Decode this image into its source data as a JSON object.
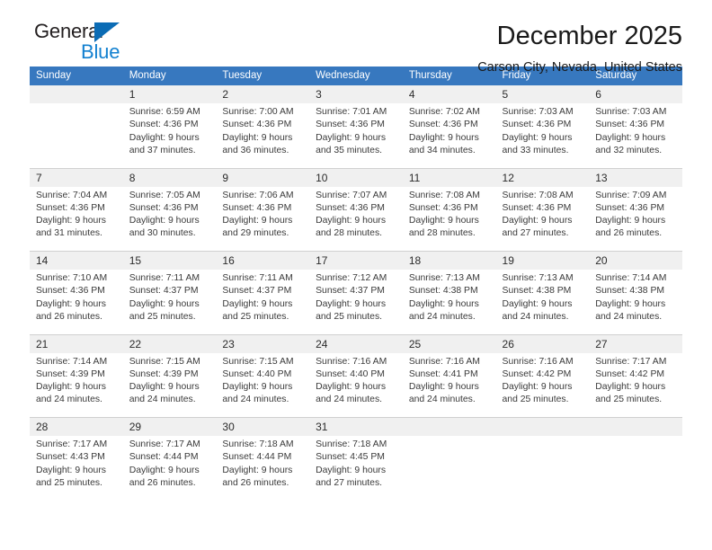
{
  "brand": {
    "word_top": "General",
    "word_bottom": "Blue",
    "triangle_color": "#0b6cb5",
    "bottom_color": "#1280d0"
  },
  "header": {
    "title": "December 2025",
    "subtitle": "Carson City, Nevada, United States"
  },
  "theme": {
    "header_row_bg": "#3778bf",
    "daynum_bg": "#f0f0f0",
    "grid_line": "#d0d0d0"
  },
  "weekdays": [
    "Sunday",
    "Monday",
    "Tuesday",
    "Wednesday",
    "Thursday",
    "Friday",
    "Saturday"
  ],
  "weeks": [
    {
      "days": [
        {
          "num": "",
          "sunrise": "",
          "sunset": "",
          "daylight1": "",
          "daylight2": ""
        },
        {
          "num": "1",
          "sunrise": "Sunrise: 6:59 AM",
          "sunset": "Sunset: 4:36 PM",
          "daylight1": "Daylight: 9 hours",
          "daylight2": "and 37 minutes."
        },
        {
          "num": "2",
          "sunrise": "Sunrise: 7:00 AM",
          "sunset": "Sunset: 4:36 PM",
          "daylight1": "Daylight: 9 hours",
          "daylight2": "and 36 minutes."
        },
        {
          "num": "3",
          "sunrise": "Sunrise: 7:01 AM",
          "sunset": "Sunset: 4:36 PM",
          "daylight1": "Daylight: 9 hours",
          "daylight2": "and 35 minutes."
        },
        {
          "num": "4",
          "sunrise": "Sunrise: 7:02 AM",
          "sunset": "Sunset: 4:36 PM",
          "daylight1": "Daylight: 9 hours",
          "daylight2": "and 34 minutes."
        },
        {
          "num": "5",
          "sunrise": "Sunrise: 7:03 AM",
          "sunset": "Sunset: 4:36 PM",
          "daylight1": "Daylight: 9 hours",
          "daylight2": "and 33 minutes."
        },
        {
          "num": "6",
          "sunrise": "Sunrise: 7:03 AM",
          "sunset": "Sunset: 4:36 PM",
          "daylight1": "Daylight: 9 hours",
          "daylight2": "and 32 minutes."
        }
      ]
    },
    {
      "days": [
        {
          "num": "7",
          "sunrise": "Sunrise: 7:04 AM",
          "sunset": "Sunset: 4:36 PM",
          "daylight1": "Daylight: 9 hours",
          "daylight2": "and 31 minutes."
        },
        {
          "num": "8",
          "sunrise": "Sunrise: 7:05 AM",
          "sunset": "Sunset: 4:36 PM",
          "daylight1": "Daylight: 9 hours",
          "daylight2": "and 30 minutes."
        },
        {
          "num": "9",
          "sunrise": "Sunrise: 7:06 AM",
          "sunset": "Sunset: 4:36 PM",
          "daylight1": "Daylight: 9 hours",
          "daylight2": "and 29 minutes."
        },
        {
          "num": "10",
          "sunrise": "Sunrise: 7:07 AM",
          "sunset": "Sunset: 4:36 PM",
          "daylight1": "Daylight: 9 hours",
          "daylight2": "and 28 minutes."
        },
        {
          "num": "11",
          "sunrise": "Sunrise: 7:08 AM",
          "sunset": "Sunset: 4:36 PM",
          "daylight1": "Daylight: 9 hours",
          "daylight2": "and 28 minutes."
        },
        {
          "num": "12",
          "sunrise": "Sunrise: 7:08 AM",
          "sunset": "Sunset: 4:36 PM",
          "daylight1": "Daylight: 9 hours",
          "daylight2": "and 27 minutes."
        },
        {
          "num": "13",
          "sunrise": "Sunrise: 7:09 AM",
          "sunset": "Sunset: 4:36 PM",
          "daylight1": "Daylight: 9 hours",
          "daylight2": "and 26 minutes."
        }
      ]
    },
    {
      "days": [
        {
          "num": "14",
          "sunrise": "Sunrise: 7:10 AM",
          "sunset": "Sunset: 4:36 PM",
          "daylight1": "Daylight: 9 hours",
          "daylight2": "and 26 minutes."
        },
        {
          "num": "15",
          "sunrise": "Sunrise: 7:11 AM",
          "sunset": "Sunset: 4:37 PM",
          "daylight1": "Daylight: 9 hours",
          "daylight2": "and 25 minutes."
        },
        {
          "num": "16",
          "sunrise": "Sunrise: 7:11 AM",
          "sunset": "Sunset: 4:37 PM",
          "daylight1": "Daylight: 9 hours",
          "daylight2": "and 25 minutes."
        },
        {
          "num": "17",
          "sunrise": "Sunrise: 7:12 AM",
          "sunset": "Sunset: 4:37 PM",
          "daylight1": "Daylight: 9 hours",
          "daylight2": "and 25 minutes."
        },
        {
          "num": "18",
          "sunrise": "Sunrise: 7:13 AM",
          "sunset": "Sunset: 4:38 PM",
          "daylight1": "Daylight: 9 hours",
          "daylight2": "and 24 minutes."
        },
        {
          "num": "19",
          "sunrise": "Sunrise: 7:13 AM",
          "sunset": "Sunset: 4:38 PM",
          "daylight1": "Daylight: 9 hours",
          "daylight2": "and 24 minutes."
        },
        {
          "num": "20",
          "sunrise": "Sunrise: 7:14 AM",
          "sunset": "Sunset: 4:38 PM",
          "daylight1": "Daylight: 9 hours",
          "daylight2": "and 24 minutes."
        }
      ]
    },
    {
      "days": [
        {
          "num": "21",
          "sunrise": "Sunrise: 7:14 AM",
          "sunset": "Sunset: 4:39 PM",
          "daylight1": "Daylight: 9 hours",
          "daylight2": "and 24 minutes."
        },
        {
          "num": "22",
          "sunrise": "Sunrise: 7:15 AM",
          "sunset": "Sunset: 4:39 PM",
          "daylight1": "Daylight: 9 hours",
          "daylight2": "and 24 minutes."
        },
        {
          "num": "23",
          "sunrise": "Sunrise: 7:15 AM",
          "sunset": "Sunset: 4:40 PM",
          "daylight1": "Daylight: 9 hours",
          "daylight2": "and 24 minutes."
        },
        {
          "num": "24",
          "sunrise": "Sunrise: 7:16 AM",
          "sunset": "Sunset: 4:40 PM",
          "daylight1": "Daylight: 9 hours",
          "daylight2": "and 24 minutes."
        },
        {
          "num": "25",
          "sunrise": "Sunrise: 7:16 AM",
          "sunset": "Sunset: 4:41 PM",
          "daylight1": "Daylight: 9 hours",
          "daylight2": "and 24 minutes."
        },
        {
          "num": "26",
          "sunrise": "Sunrise: 7:16 AM",
          "sunset": "Sunset: 4:42 PM",
          "daylight1": "Daylight: 9 hours",
          "daylight2": "and 25 minutes."
        },
        {
          "num": "27",
          "sunrise": "Sunrise: 7:17 AM",
          "sunset": "Sunset: 4:42 PM",
          "daylight1": "Daylight: 9 hours",
          "daylight2": "and 25 minutes."
        }
      ]
    },
    {
      "days": [
        {
          "num": "28",
          "sunrise": "Sunrise: 7:17 AM",
          "sunset": "Sunset: 4:43 PM",
          "daylight1": "Daylight: 9 hours",
          "daylight2": "and 25 minutes."
        },
        {
          "num": "29",
          "sunrise": "Sunrise: 7:17 AM",
          "sunset": "Sunset: 4:44 PM",
          "daylight1": "Daylight: 9 hours",
          "daylight2": "and 26 minutes."
        },
        {
          "num": "30",
          "sunrise": "Sunrise: 7:18 AM",
          "sunset": "Sunset: 4:44 PM",
          "daylight1": "Daylight: 9 hours",
          "daylight2": "and 26 minutes."
        },
        {
          "num": "31",
          "sunrise": "Sunrise: 7:18 AM",
          "sunset": "Sunset: 4:45 PM",
          "daylight1": "Daylight: 9 hours",
          "daylight2": "and 27 minutes."
        },
        {
          "num": "",
          "sunrise": "",
          "sunset": "",
          "daylight1": "",
          "daylight2": ""
        },
        {
          "num": "",
          "sunrise": "",
          "sunset": "",
          "daylight1": "",
          "daylight2": ""
        },
        {
          "num": "",
          "sunrise": "",
          "sunset": "",
          "daylight1": "",
          "daylight2": ""
        }
      ]
    }
  ]
}
